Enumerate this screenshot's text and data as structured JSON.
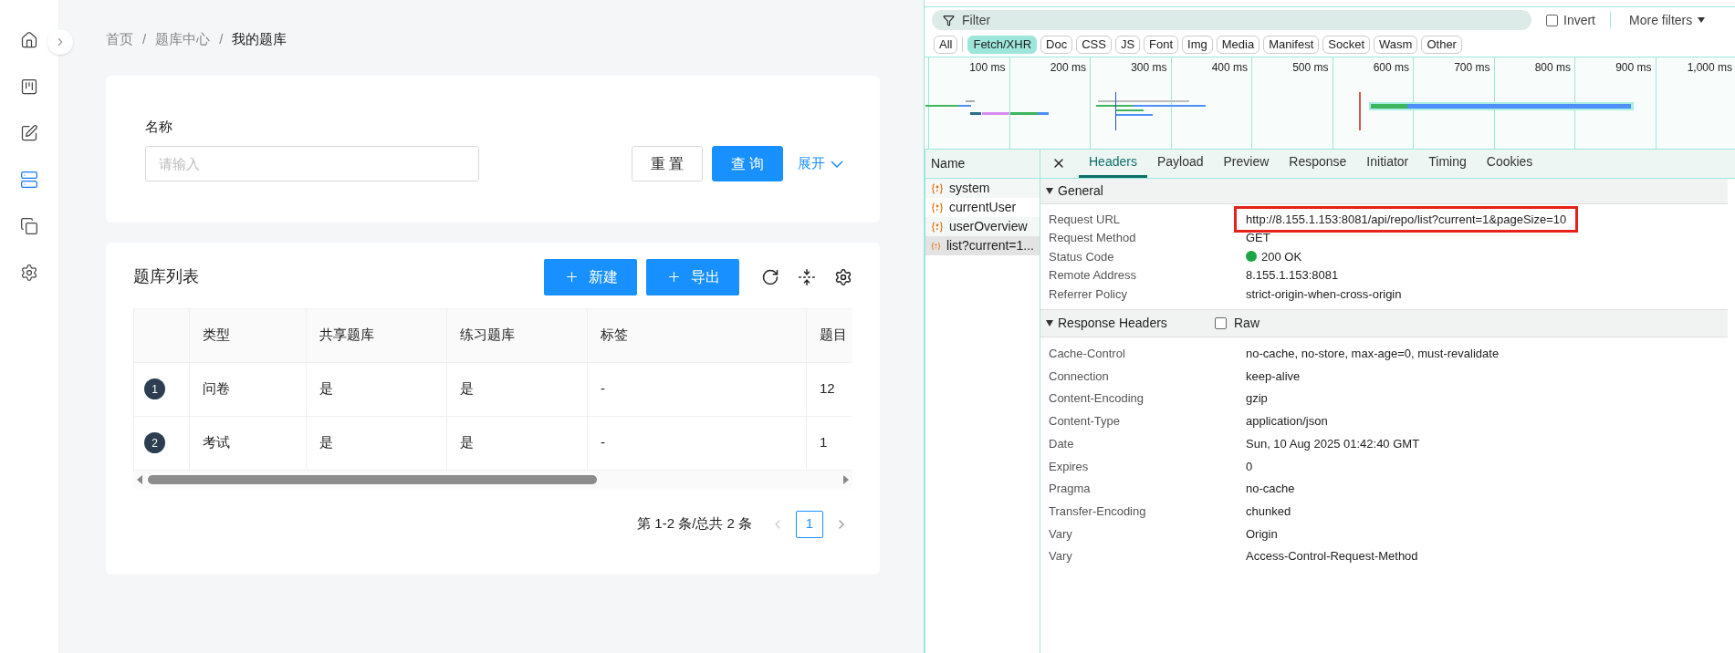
{
  "sidebar": {
    "items": [
      {
        "kind": "home",
        "selected": false
      },
      {
        "kind": "board",
        "selected": false
      },
      {
        "kind": "edit",
        "selected": false
      },
      {
        "kind": "database",
        "selected": true
      },
      {
        "kind": "copy",
        "selected": false
      },
      {
        "kind": "settings",
        "selected": false
      }
    ]
  },
  "breadcrumb": {
    "separator": "/",
    "items": [
      "首页",
      "题库中心",
      "我的题库"
    ]
  },
  "search_form": {
    "label": "名称",
    "placeholder": "请输入",
    "buttons": [
      {
        "kind": "default",
        "label": "重 置"
      },
      {
        "kind": "primary",
        "label": "查 询"
      }
    ],
    "expand_link": "展开"
  },
  "table_card": {
    "title": "题库列表",
    "buttons": [
      "新建",
      "导出"
    ],
    "columns": [
      "类型",
      "共享题库",
      "练习题库",
      "标签",
      "题目"
    ],
    "rows": [
      {
        "index": "1",
        "cells": [
          "问卷",
          "是",
          "是",
          "-",
          "12"
        ]
      },
      {
        "index": "2",
        "cells": [
          "考试",
          "是",
          "是",
          "-",
          "1"
        ]
      }
    ],
    "pagination": {
      "summary": "第 1-2 条/总共 2 条",
      "pages": [
        {
          "label": "1",
          "selected": true
        }
      ]
    }
  },
  "devtools": {
    "filter": {
      "placeholder": "Filter",
      "invert": {
        "label": "Invert",
        "checked": false
      },
      "more_filters": "More filters"
    },
    "type_filters": [
      {
        "label": "All",
        "selected": false
      },
      {
        "label": "Fetch/XHR",
        "selected": true
      },
      {
        "label": "Doc",
        "selected": false
      },
      {
        "label": "CSS",
        "selected": false
      },
      {
        "label": "JS",
        "selected": false
      },
      {
        "label": "Font",
        "selected": false
      },
      {
        "label": "Img",
        "selected": false
      },
      {
        "label": "Media",
        "selected": false
      },
      {
        "label": "Manifest",
        "selected": false
      },
      {
        "label": "Socket",
        "selected": false
      },
      {
        "label": "Wasm",
        "selected": false
      },
      {
        "label": "Other",
        "selected": false
      }
    ],
    "timeline": {
      "ticks": [
        "100 ms",
        "200 ms",
        "300 ms",
        "400 ms",
        "500 ms",
        "600 ms",
        "700 ms",
        "800 ms",
        "900 ms",
        "1,000 ms"
      ]
    },
    "requests": {
      "header": "Name",
      "items": [
        {
          "name": "system",
          "selected": false
        },
        {
          "name": "currentUser",
          "selected": false
        },
        {
          "name": "userOverview",
          "selected": false
        },
        {
          "name": "list?current=1...",
          "selected": true
        }
      ]
    },
    "tabs": [
      {
        "label": "Headers",
        "selected": true
      },
      {
        "label": "Payload",
        "selected": false
      },
      {
        "label": "Preview",
        "selected": false
      },
      {
        "label": "Response",
        "selected": false
      },
      {
        "label": "Initiator",
        "selected": false
      },
      {
        "label": "Timing",
        "selected": false
      },
      {
        "label": "Cookies",
        "selected": false
      }
    ],
    "general": {
      "title": "General",
      "expanded": true,
      "rows": [
        {
          "key": "Request URL",
          "value": "http://8.155.1.153:8081/api/repo/list?current=1&pageSize=10",
          "highlighted": true
        },
        {
          "key": "Request Method",
          "value": "GET",
          "highlighted": false
        },
        {
          "key": "Status Code",
          "value": "200 OK",
          "color": "#1ea446",
          "highlighted": false
        },
        {
          "key": "Remote Address",
          "value": "8.155.1.153:8081",
          "highlighted": false
        },
        {
          "key": "Referrer Policy",
          "value": "strict-origin-when-cross-origin",
          "highlighted": false
        }
      ]
    },
    "response_headers": {
      "title": "Response Headers",
      "expanded": true,
      "raw": {
        "label": "Raw",
        "checked": false
      },
      "rows": [
        {
          "key": "Cache-Control",
          "value": "no-cache, no-store, max-age=0, must-revalidate"
        },
        {
          "key": "Connection",
          "value": "keep-alive"
        },
        {
          "key": "Content-Encoding",
          "value": "gzip"
        },
        {
          "key": "Content-Type",
          "value": "application/json"
        },
        {
          "key": "Date",
          "value": "Sun, 10 Aug 2025 01:42:40 GMT"
        },
        {
          "key": "Expires",
          "value": "0"
        },
        {
          "key": "Pragma",
          "value": "no-cache"
        },
        {
          "key": "Transfer-Encoding",
          "value": "chunked"
        },
        {
          "key": "Vary",
          "value": "Origin"
        },
        {
          "key": "Vary",
          "value": "Access-Control-Request-Method"
        }
      ]
    }
  }
}
